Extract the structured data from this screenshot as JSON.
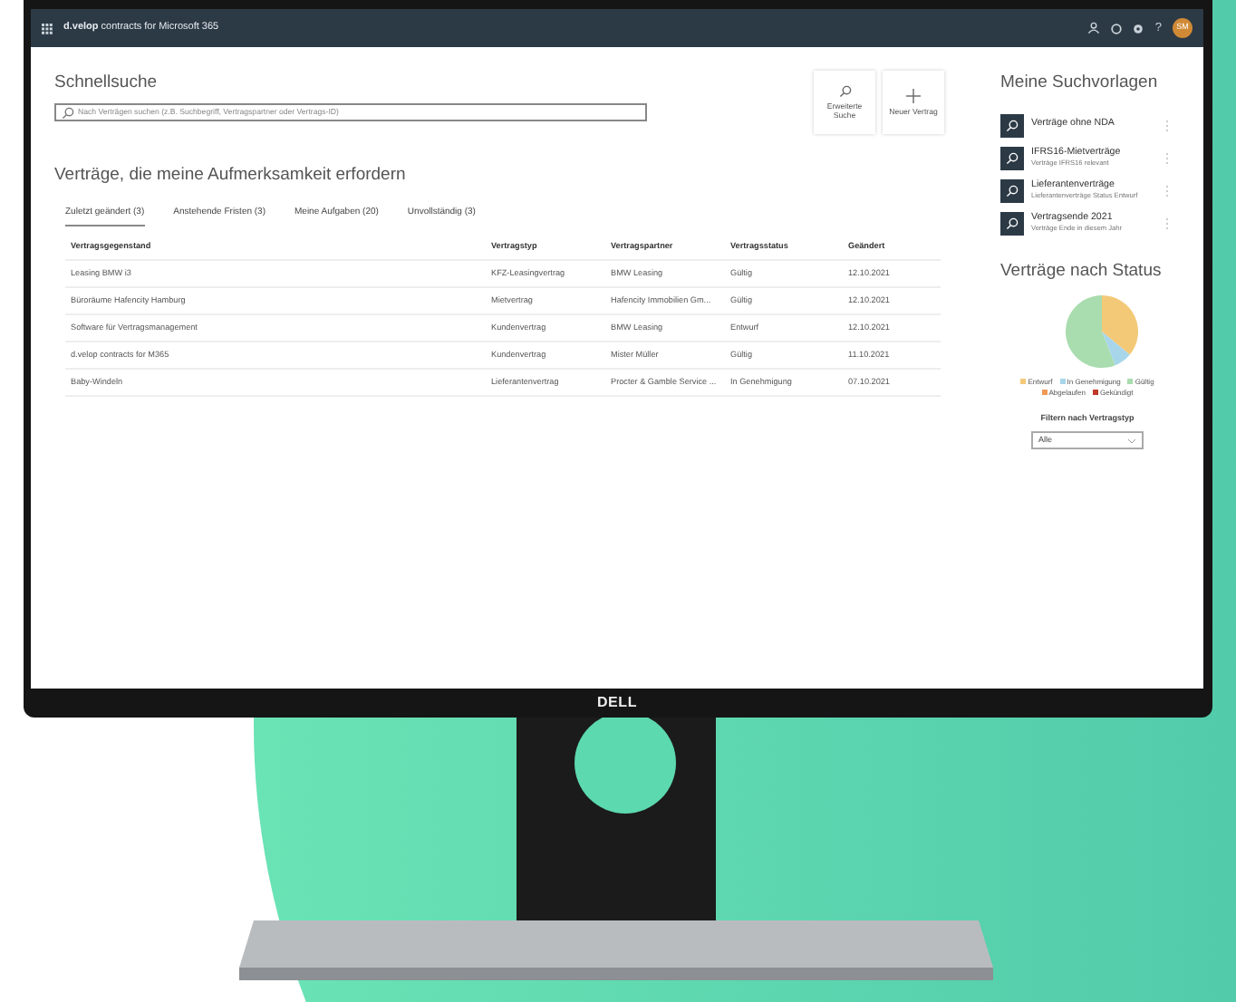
{
  "app_bar": {
    "title": "**d.velop** contracts for Microsoft 365",
    "help": "?",
    "avatar": "SM"
  },
  "quick_search": {
    "title": "Schnellsuche",
    "placeholder": "Nach Verträgen suchen (z.B. Suchbegriff, Vertragspartner oder Vertrags-ID)"
  },
  "actions": [
    {
      "kind": "search",
      "label": "Erweiterte Suche"
    },
    {
      "kind": "add",
      "label": "Neuer Vertrag"
    }
  ],
  "attention": {
    "title": "Verträge, die meine Aufmerksamkeit erfordern",
    "tabs": [
      {
        "label": "Zuletzt geändert (3)",
        "selected": true
      },
      {
        "label": "Anstehende Fristen (3)",
        "selected": false
      },
      {
        "label": "Meine Aufgaben (20)",
        "selected": false
      },
      {
        "label": "Unvollständig (3)",
        "selected": false
      }
    ],
    "columns": [
      "Vertragsgegenstand",
      "Vertragstyp",
      "Vertragspartner",
      "Vertragsstatus",
      "Geändert"
    ],
    "rows": [
      [
        "Leasing BMW i3",
        "KFZ-Leasingvertrag",
        "BMW Leasing",
        "Gültig",
        "12.10.2021"
      ],
      [
        "Büroräume Hafencity Hamburg",
        "Mietvertrag",
        "Hafencity Immobilien Gm...",
        "Gültig",
        "12.10.2021"
      ],
      [
        "Software für Vertragsmanagement",
        "Kundenvertrag",
        "BMW Leasing",
        "Entwurf",
        "12.10.2021"
      ],
      [
        "d.velop contracts for M365",
        "Kundenvertrag",
        "Mister Müller",
        "Gültig",
        "11.10.2021"
      ],
      [
        "Baby-Windeln",
        "Lieferantenvertrag",
        "Procter & Gamble Service ...",
        "In Genehmigung",
        "07.10.2021"
      ]
    ]
  },
  "saved_searches": {
    "title": "Meine Suchvorlagen",
    "items": [
      {
        "name": "Verträge ohne NDA"
      },
      {
        "name": "IFRS16-Mietverträge",
        "description": "Verträge IFRS16 relevant"
      },
      {
        "name": "Lieferantenverträge",
        "description": "Lieferantenverträge Status Entwurf"
      },
      {
        "name": "Vertragsende 2021",
        "description": "Verträge Ende in diesem Jahr"
      }
    ]
  },
  "status_chart": {
    "title": "Verträge nach Status",
    "legend": [
      {
        "label": "Entwurf",
        "color": "#f3c978"
      },
      {
        "label": "In Genehmigung",
        "color": "#a7d6ea"
      },
      {
        "label": "Gültig",
        "color": "#a9dcae"
      },
      {
        "label": "Abgelaufen",
        "color": "#ef9a55"
      },
      {
        "label": "Gekündigt",
        "color": "#c0392b"
      }
    ],
    "filter_label": "Filtern nach Vertragstyp",
    "filter_value": "Alle"
  },
  "monitor": {
    "brand": "DELL"
  }
}
